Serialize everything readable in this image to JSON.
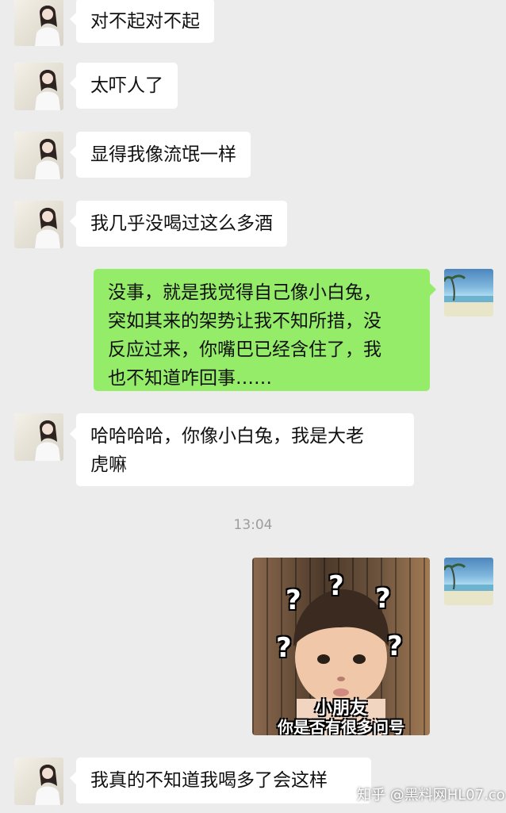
{
  "colors": {
    "background": "#ececec",
    "incoming_bubble": "#ffffff",
    "outgoing_bubble": "#95ec69",
    "time_text": "#9d9d9d"
  },
  "chat": {
    "messages": [
      {
        "side": "left",
        "text": "对不起对不起"
      },
      {
        "side": "left",
        "text": "太吓人了"
      },
      {
        "side": "left",
        "text": "显得我像流氓一样"
      },
      {
        "side": "left",
        "text": "我几乎没喝过这么多酒"
      },
      {
        "side": "right",
        "line1": "没事，就是我觉得自己像小白兔，",
        "line2": "突如其来的架势让我不知所措，没",
        "line3": "反应过来，你嘴巴已经含住了，我",
        "line4": "也不知道咋回事……"
      },
      {
        "side": "left",
        "line1": "哈哈哈哈，你像小白兔，我是大老",
        "line2": "虎嘛"
      },
      {
        "side": "left",
        "text": "我真的不知道我喝多了会这样"
      }
    ],
    "time": "13:04",
    "sticker": {
      "caption_top": "小朋友",
      "caption_bottom": "你是否有很多问号",
      "qmark": "?"
    },
    "watermark": "知乎 @黑料网HL07.co"
  },
  "icons": {
    "incoming_avatar": "girl-avatar-icon",
    "outgoing_avatar": "beach-avatar-icon"
  }
}
